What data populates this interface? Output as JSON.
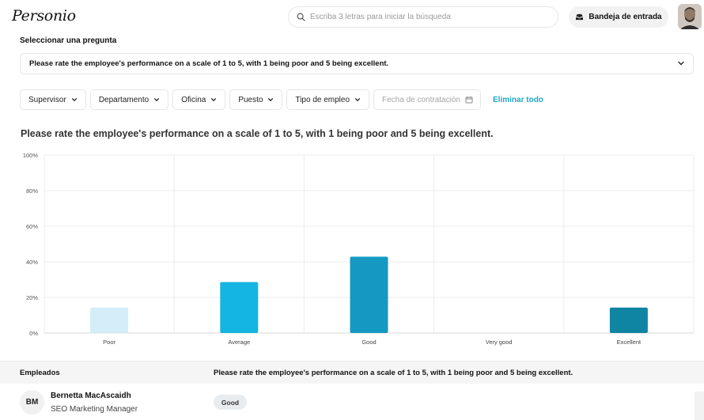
{
  "header": {
    "logo_text": "Personio",
    "search_placeholder": "Escriba 3 letras para iniciar la búsqueda",
    "inbox_label": "Bandeja de entrada"
  },
  "question": {
    "label": "Seleccionar una pregunta",
    "selected": "Please rate the employee's performance on a scale of 1 to 5, with 1 being poor and 5 being excellent."
  },
  "filters": {
    "items": [
      "Supervisor",
      "Departamento",
      "Oficina",
      "Puesto",
      "Tipo de empleo"
    ],
    "date_placeholder": "Fecha de contratación",
    "clear_all": "Eliminar todo"
  },
  "chart_data": {
    "type": "bar",
    "title": "Please rate the employee's performance on a scale of 1 to 5, with 1 being poor and 5 being excellent.",
    "categories": [
      "Poor",
      "Average",
      "Good",
      "Very good",
      "Excellent"
    ],
    "values": [
      14.3,
      28.6,
      42.9,
      0,
      14.3
    ],
    "colors": [
      "#d3eef8",
      "#14b5e0",
      "#1599c2",
      "#1599c2",
      "#0f84a3"
    ],
    "ylim": [
      0,
      100
    ],
    "yticks": [
      "0%",
      "20%",
      "40%",
      "60%",
      "80%",
      "100%"
    ],
    "grid": true
  },
  "table": {
    "col_employees": "Empleados",
    "col_question": "Please rate the employee's performance on a scale of 1 to 5, with 1 being poor and 5 being excellent.",
    "rows": [
      {
        "initials": "BM",
        "name": "Bernetta MacAscaidh",
        "role": "SEO Marketing Manager",
        "answer": "Good"
      }
    ]
  }
}
